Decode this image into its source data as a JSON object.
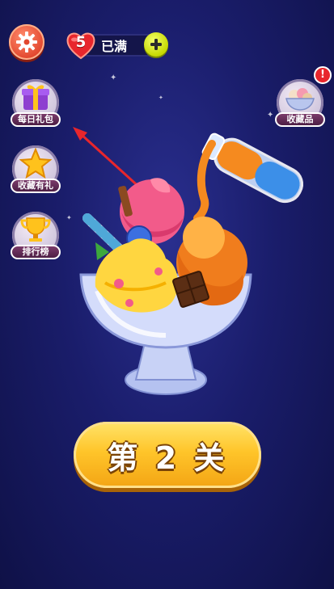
{
  "top_bar": {
    "lives_count": "5",
    "lives_status": "已满"
  },
  "side_buttons": {
    "daily_gift": "每日礼包",
    "favorite_reward": "收藏有礼",
    "leaderboard": "排行榜",
    "collection": "收藏品"
  },
  "collection_badge": "!",
  "level_button": {
    "label": "第 2 关"
  },
  "colors": {
    "background": "#1a1d6b",
    "level_button": "#ffc52a",
    "settings_button": "#e2472e",
    "add_button": "#c6d900",
    "heart": "#e8262c"
  }
}
